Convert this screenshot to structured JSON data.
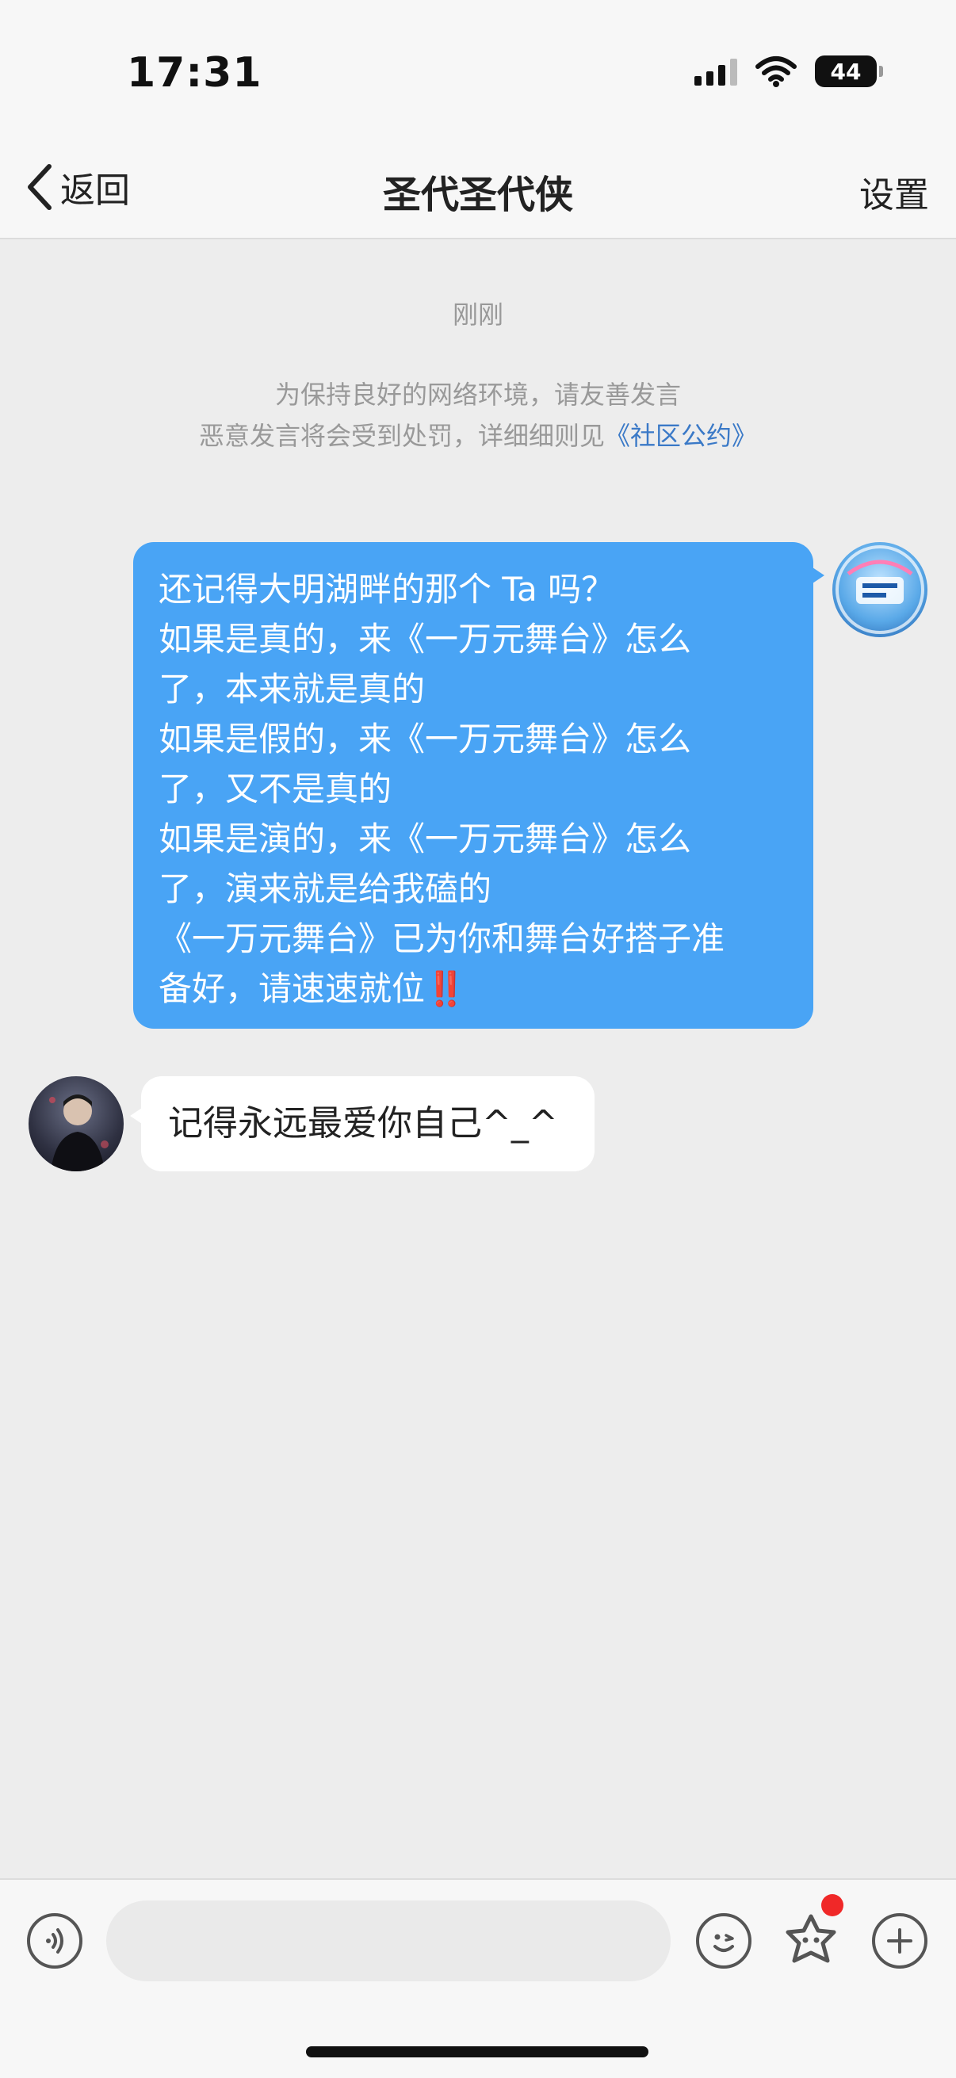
{
  "status_bar": {
    "time": "17:31",
    "battery": "44",
    "icons": [
      "signal-icon",
      "wifi-icon",
      "battery-icon"
    ]
  },
  "nav": {
    "back_label": "返回",
    "title": "圣代圣代侠",
    "settings_label": "设置"
  },
  "chat": {
    "timestamp": "刚刚",
    "notice_line1": "为保持良好的网络环境，请友善发言",
    "notice_line2_prefix": "恶意发言将会受到处罚，详细细则见",
    "notice_link": "《社区公约》",
    "messages": [
      {
        "direction": "outgoing",
        "lines": [
          "还记得大明湖畔的那个 Ta 吗？",
          "如果是真的，来《一万元舞台》怎么",
          "了，本来就是真的",
          "如果是假的，来《一万元舞台》怎么",
          "了，又不是真的",
          "如果是演的，来《一万元舞台》怎么",
          "了，演来就是给我磕的",
          "《一万元舞台》已为你和舞台好搭子准",
          "备好，请速速就位‼️"
        ],
        "avatar": "一万元舞台"
      },
      {
        "direction": "incoming",
        "text": "记得永远最爱你自己^_^"
      }
    ]
  },
  "input_bar": {
    "input_value": "",
    "icons": [
      "voice-icon",
      "emoji-icon",
      "sticker-icon",
      "plus-icon"
    ],
    "badge_color": "#f02828"
  },
  "colors": {
    "outgoing_bubble": "#49a4f5",
    "incoming_bubble": "#ffffff",
    "background": "#ededed",
    "link": "#3a79c7"
  }
}
